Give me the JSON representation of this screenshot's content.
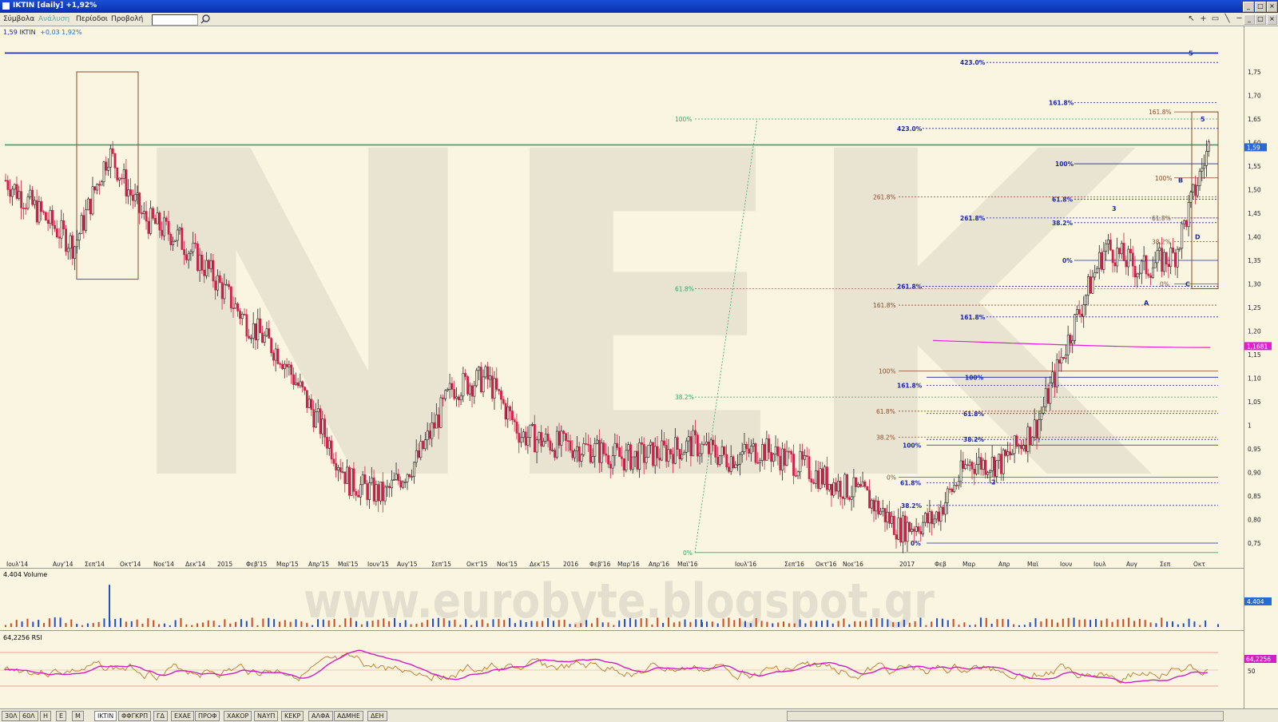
{
  "window": {
    "title": "IKTIN [daily] +1,92%"
  },
  "menu": {
    "items": [
      "Σύμβολα",
      "Ανάλυση",
      "Περίοδοι",
      "Προβολή"
    ]
  },
  "panels": {
    "price": {
      "legend": "1,59 IKTIN",
      "change": "+0,03 1,92%"
    },
    "volume": {
      "legend": "4.404 Volume",
      "last": "4.404"
    },
    "rsi": {
      "legend": "64,2256 RSI",
      "last": "64,2256",
      "ticks": [
        "50"
      ]
    }
  },
  "price_axis": {
    "ticks": [
      "1,75",
      "1,70",
      "1,65",
      "1,60",
      "1,55",
      "1,50",
      "1,45",
      "1,40",
      "1,35",
      "1,30",
      "1,25",
      "1,20",
      "1,15",
      "1,10",
      "1,05",
      "1",
      "0,95",
      "0,90",
      "0,85",
      "0,80",
      "0,75"
    ],
    "last_price": "1,59",
    "ma_value": "1,1681"
  },
  "time_axis": [
    "Ιουλ'14",
    "Αυγ'14",
    "Σεπ'14",
    "Οκτ'14",
    "Νοε'14",
    "Δεκ'14",
    "2015",
    "Φεβ'15",
    "Μαρ'15",
    "Απρ'15",
    "Μαϊ'15",
    "Ιουν'15",
    "Αυγ'15",
    "Σεπ'15",
    "Οκτ'15",
    "Νοε'15",
    "Δεκ'15",
    "2016",
    "Φεβ'16",
    "Μαρ'16",
    "Απρ'16",
    "Μαϊ'16",
    "Ιουλ'16",
    "Σεπ'16",
    "Οκτ'16",
    "Νοε'16",
    "2017",
    "Φεβ",
    "Μαρ",
    "Απρ",
    "Μαϊ",
    "Ιουν",
    "Ιουλ",
    "Αυγ",
    "Σεπ",
    "Οκτ"
  ],
  "fib_labels": {
    "green": [
      "100%",
      "61.8%",
      "38.2%",
      "0%"
    ],
    "blue_upper": [
      "423.0%",
      "161.8%",
      "423.0%",
      "100%",
      "261.8%",
      "261.8%",
      "161.8%"
    ],
    "blue_mid": [
      "61.8%",
      "38.2%",
      "0%"
    ],
    "brown": [
      "261.8%",
      "161.8%",
      "100%",
      "61.8%",
      "38.2%",
      "0%"
    ],
    "blue_lower": [
      "100%",
      "161.8%",
      "61.8%",
      "38.2%",
      "100%",
      "61.8%",
      "38.2%",
      "0%"
    ],
    "right_small": [
      "161.8%",
      "100%",
      "61.8%",
      "38.2%",
      "0%"
    ]
  },
  "wave_labels": [
    "5",
    "3",
    "B",
    "A",
    "C",
    "D",
    "2",
    "5"
  ],
  "watermark": {
    "big": "NEK",
    "url": "www.eurobyte.blogspot.gr"
  },
  "bottom_tabs": [
    "30Λ",
    "60Λ",
    "H",
    "E",
    "M",
    "IKTIN",
    "ΦΦΓΚΡΠ",
    "ΓΔ",
    "ΕΧΑΕ",
    "ΠΡΟΦ",
    "ΧΑΚΟΡ",
    "ΝΑΥΠ",
    "ΚΕΚΡ",
    "ΑΛΦΑ",
    "ΑΔΜΗΕ",
    "ΔΕΗ"
  ],
  "colors": {
    "bg": "#faf5e1",
    "up": "#222222",
    "down": "#d0204a",
    "fib_blue": "#1a2a9e",
    "fib_green": "#2ea86a",
    "fib_brown": "#8a4a2a",
    "ma": "#e020d0",
    "rsi": "#d020c0",
    "rsi_fast": "#b86a10",
    "volume_up": "#1f4fd0",
    "volume_down": "#d04a20"
  },
  "chart_data": {
    "type": "candlestick",
    "price_series": {
      "name": "IKTIN",
      "x": [
        "Ιουλ'14",
        "Αυγ'14",
        "Σεπ'14",
        "Οκτ'14",
        "Νοε'14",
        "Δεκ'14",
        "2015",
        "Φεβ'15",
        "Μαρ'15",
        "Απρ'15",
        "Μαϊ'15",
        "Ιουν'15",
        "Αυγ'15",
        "Σεπ'15",
        "Οκτ'15",
        "Νοε'15",
        "Δεκ'15",
        "2016",
        "Φεβ'16",
        "Μαρ'16",
        "Απρ'16",
        "Μαϊ'16",
        "Ιουλ'16",
        "Σεπ'16",
        "Οκτ'16",
        "Νοε'16",
        "2017",
        "Φεβ",
        "Μαρ",
        "Απρ",
        "Μαϊ",
        "Ιουν",
        "Ιουλ",
        "Αυγ",
        "Σεπ",
        "Οκτ"
      ],
      "close": [
        1.52,
        1.45,
        1.38,
        1.58,
        1.44,
        1.4,
        1.32,
        1.22,
        1.15,
        1.02,
        0.88,
        0.85,
        0.93,
        1.08,
        1.1,
        0.98,
        0.96,
        0.95,
        0.93,
        0.94,
        0.96,
        0.93,
        0.95,
        0.92,
        0.88,
        0.85,
        0.78,
        0.8,
        0.92,
        0.92,
        1.0,
        1.2,
        1.38,
        1.33,
        1.36,
        1.59
      ]
    },
    "volume_peaks": [
      {
        "x": "Σεπ'14",
        "value": 4.4
      },
      {
        "x": "Μαϊ'16",
        "value": 0.5
      },
      {
        "x": "Οκτ",
        "value": 0.3
      }
    ],
    "ylim": [
      0.72,
      1.78
    ]
  }
}
